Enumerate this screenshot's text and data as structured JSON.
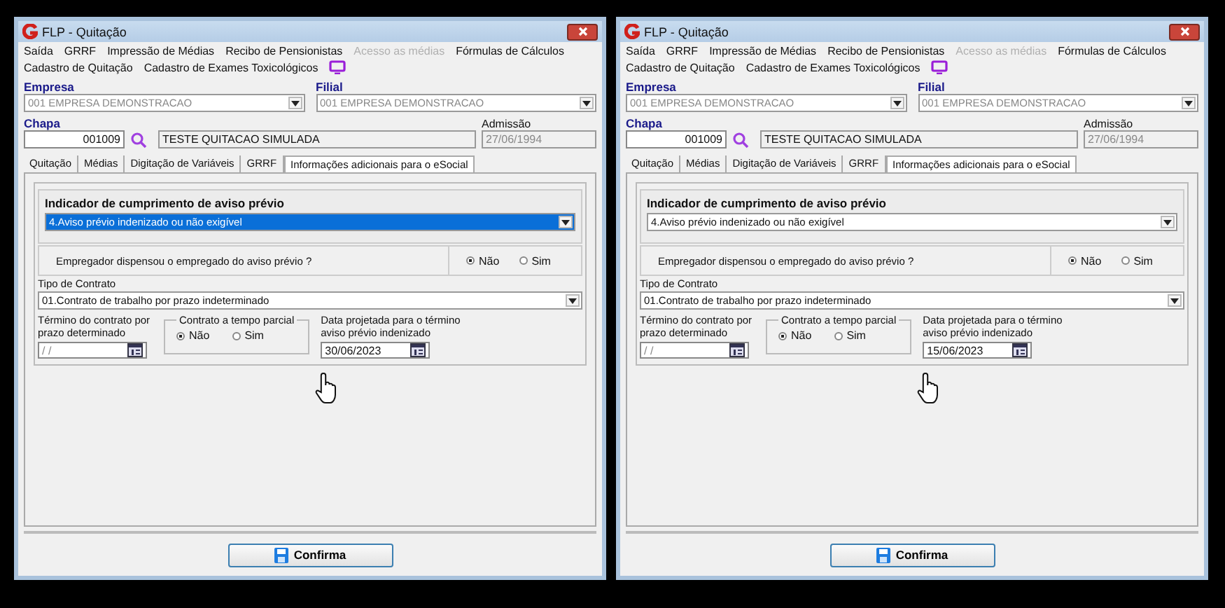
{
  "windows": [
    {
      "title": "FLP - Quitação",
      "menu": [
        {
          "label": "Saída",
          "disabled": false
        },
        {
          "label": "GRRF",
          "disabled": false
        },
        {
          "label": "Impressão de Médias",
          "disabled": false
        },
        {
          "label": "Recibo de Pensionistas",
          "disabled": false
        },
        {
          "label": "Acesso as médias",
          "disabled": true
        },
        {
          "label": "Fórmulas de Cálculos",
          "disabled": false
        },
        {
          "label": "Cadastro de Quitação",
          "disabled": false
        },
        {
          "label": "Cadastro de Exames Toxicológicos",
          "disabled": false
        }
      ],
      "empresa": {
        "label": "Empresa",
        "value": "001 EMPRESA DEMONSTRACAO"
      },
      "filial": {
        "label": "Filial",
        "value": "001 EMPRESA DEMONSTRACAO"
      },
      "chapa": {
        "label": "Chapa",
        "value": "001009"
      },
      "nome": {
        "value": "TESTE QUITACAO SIMULADA"
      },
      "admissao": {
        "label": "Admissão",
        "value": "27/06/1994"
      },
      "tabs": [
        {
          "label": "Quitação",
          "selected": false
        },
        {
          "label": "Médias",
          "selected": false
        },
        {
          "label": "Digitação de Variáveis",
          "selected": false
        },
        {
          "label": "GRRF",
          "selected": false
        },
        {
          "label": "Informações adicionais para o eSocial",
          "selected": true
        }
      ],
      "indicador": {
        "label": "Indicador de cumprimento de aviso prévio",
        "value": "4.Aviso prévio indenizado ou não exigível",
        "highlighted": true
      },
      "dispensa": {
        "label": "Empregador dispensou o empregado do aviso prévio ?",
        "options": [
          {
            "label": "Não",
            "selected": true
          },
          {
            "label": "Sim",
            "selected": false
          }
        ]
      },
      "tipo_contrato": {
        "label": "Tipo de Contrato",
        "value": "01.Contrato de trabalho por prazo indeterminado"
      },
      "termino": {
        "label": "Término do contrato por prazo determinado",
        "value": " / /"
      },
      "tempo_parcial": {
        "label": "Contrato a tempo parcial",
        "options": [
          {
            "label": "Não",
            "selected": true
          },
          {
            "label": "Sim",
            "selected": false
          }
        ]
      },
      "data_projetada": {
        "label": "Data projetada para o término aviso prévio indenizado",
        "value": "30/06/2023"
      },
      "confirm_button": "Confirma"
    },
    {
      "title": "FLP - Quitação",
      "menu": [
        {
          "label": "Saída",
          "disabled": false
        },
        {
          "label": "GRRF",
          "disabled": false
        },
        {
          "label": "Impressão de Médias",
          "disabled": false
        },
        {
          "label": "Recibo de Pensionistas",
          "disabled": false
        },
        {
          "label": "Acesso as médias",
          "disabled": true
        },
        {
          "label": "Fórmulas de Cálculos",
          "disabled": false
        },
        {
          "label": "Cadastro de Quitação",
          "disabled": false
        },
        {
          "label": "Cadastro de Exames Toxicológicos",
          "disabled": false
        }
      ],
      "empresa": {
        "label": "Empresa",
        "value": "001 EMPRESA DEMONSTRACAO"
      },
      "filial": {
        "label": "Filial",
        "value": "001 EMPRESA DEMONSTRACAO"
      },
      "chapa": {
        "label": "Chapa",
        "value": "001009"
      },
      "nome": {
        "value": "TESTE QUITACAO SIMULADA"
      },
      "admissao": {
        "label": "Admissão",
        "value": "27/06/1994"
      },
      "tabs": [
        {
          "label": "Quitação",
          "selected": false
        },
        {
          "label": "Médias",
          "selected": false
        },
        {
          "label": "Digitação de Variáveis",
          "selected": false
        },
        {
          "label": "GRRF",
          "selected": false
        },
        {
          "label": "Informações adicionais para o eSocial",
          "selected": true
        }
      ],
      "indicador": {
        "label": "Indicador de cumprimento de aviso prévio",
        "value": "4.Aviso prévio indenizado ou não exigível",
        "highlighted": false
      },
      "dispensa": {
        "label": "Empregador dispensou o empregado do aviso prévio ?",
        "options": [
          {
            "label": "Não",
            "selected": true
          },
          {
            "label": "Sim",
            "selected": false
          }
        ]
      },
      "tipo_contrato": {
        "label": "Tipo de Contrato",
        "value": "01.Contrato de trabalho por prazo indeterminado"
      },
      "termino": {
        "label": "Término do contrato por prazo determinado",
        "value": " / /"
      },
      "tempo_parcial": {
        "label": "Contrato a tempo parcial",
        "options": [
          {
            "label": "Não",
            "selected": true
          },
          {
            "label": "Sim",
            "selected": false
          }
        ]
      },
      "data_projetada": {
        "label": "Data projetada para o término aviso prévio indenizado",
        "value": "15/06/2023"
      },
      "confirm_button": "Confirma"
    }
  ]
}
